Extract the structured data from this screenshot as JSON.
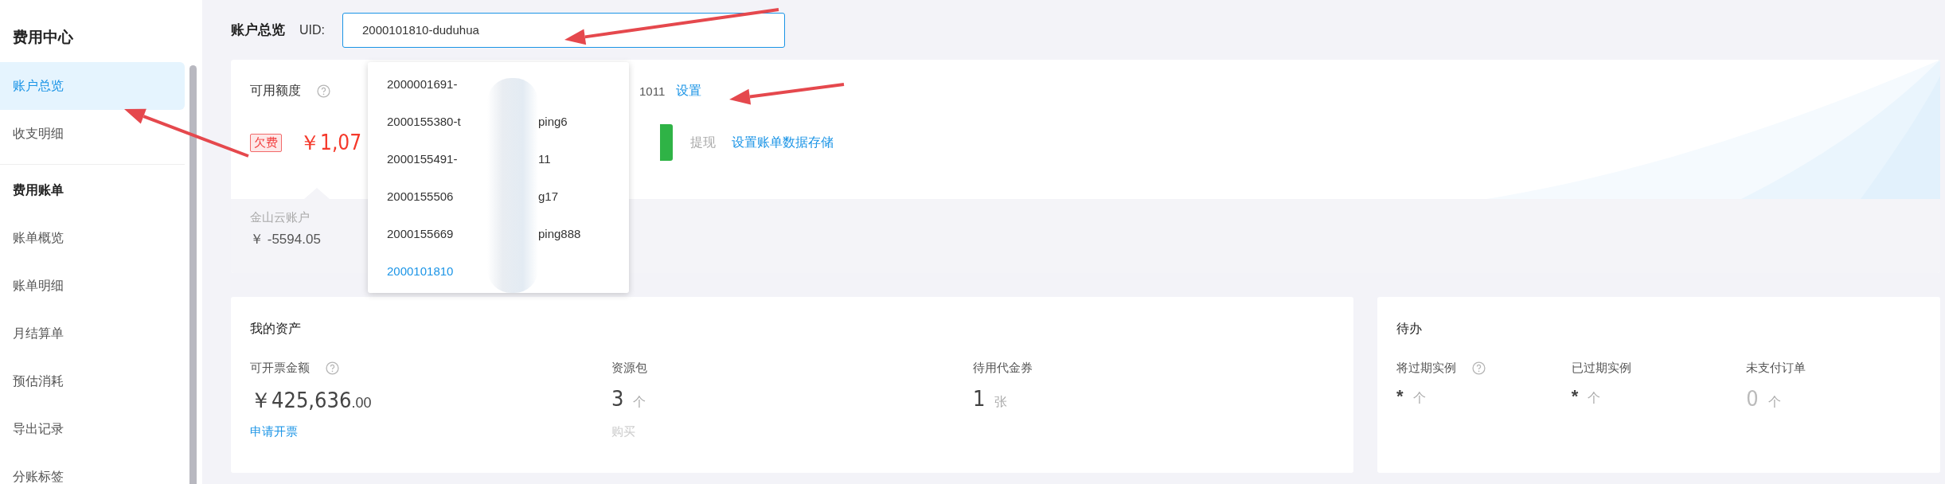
{
  "sidebar": {
    "title": "费用中心",
    "groups": [
      {
        "items": [
          {
            "label": "账户总览",
            "selected": true
          },
          {
            "label": "收支明细",
            "selected": false
          }
        ]
      },
      {
        "title": "费用账单",
        "items": [
          {
            "label": "账单概览",
            "selected": false
          },
          {
            "label": "账单明细",
            "selected": false
          },
          {
            "label": "月结算单",
            "selected": false
          },
          {
            "label": "预估消耗",
            "selected": false
          },
          {
            "label": "导出记录",
            "selected": false
          },
          {
            "label": "分账标签",
            "selected": false
          }
        ]
      }
    ]
  },
  "header": {
    "title": "账户总览",
    "uid_label": "UID:",
    "uid_value": "2000101810-duduhua"
  },
  "uid_dropdown": [
    {
      "prefix": "2000001691-",
      "selected": false
    },
    {
      "prefix": "2000155380-t",
      "suffix": "ping6",
      "selected": false
    },
    {
      "prefix": "2000155491-",
      "suffix": "11",
      "selected": false
    },
    {
      "prefix": "2000155506",
      "suffix": "g17",
      "selected": false
    },
    {
      "prefix": "2000155669",
      "suffix": "ping888",
      "selected": false
    },
    {
      "prefix": "2000101810",
      "selected": true
    }
  ],
  "credit_card": {
    "title": "可用额度",
    "alert_suffix": "1011",
    "settings_link": "设置",
    "badge": "欠费",
    "amount": "￥1,07",
    "withdraw": "提现",
    "storage_link": "设置账单数据存储",
    "account_label": "金山云账户",
    "account_amount": "￥ -5594.05"
  },
  "assets": {
    "title": "我的资产",
    "stats": [
      {
        "label": "可开票金额",
        "help": true,
        "value": "￥425,636",
        "decimals": ".00",
        "link": "申请开票",
        "link_disabled": false
      },
      {
        "label": "资源包",
        "help": false,
        "value": "3",
        "unit": "个",
        "link": "购买",
        "link_disabled": true
      },
      {
        "label": "待用代金券",
        "help": false,
        "value": "1",
        "unit": "张"
      }
    ]
  },
  "todo": {
    "title": "待办",
    "stats": [
      {
        "label": "将过期实例",
        "help": true,
        "value": "*",
        "unit": "个",
        "muted": false
      },
      {
        "label": "已过期实例",
        "help": false,
        "value": "*",
        "unit": "个",
        "muted": false
      },
      {
        "label": "未支付订单",
        "help": false,
        "value": "0",
        "unit": "个",
        "muted": true
      }
    ]
  }
}
